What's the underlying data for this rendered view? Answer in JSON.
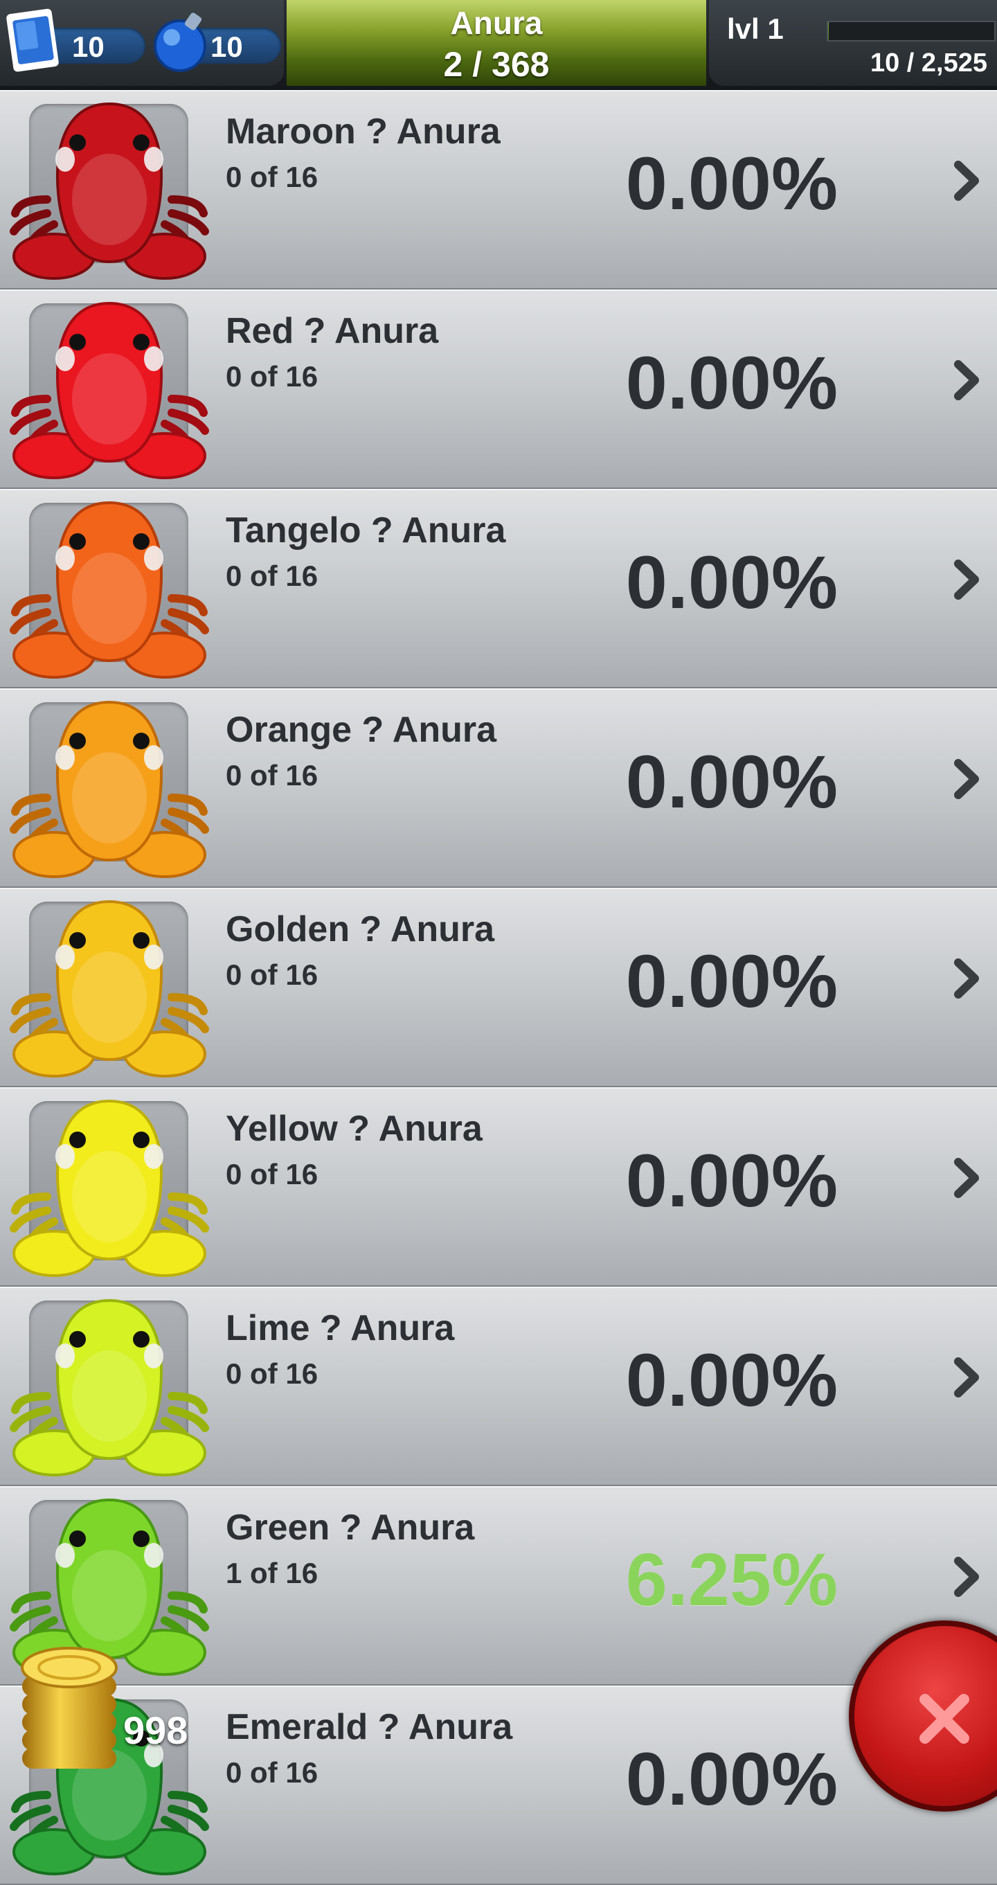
{
  "header": {
    "stamps_count": "10",
    "potions_count": "10",
    "title": "Anura",
    "collection_count": "2 / 368",
    "level_label": "lvl 1",
    "xp_text": "10 / 2,525",
    "xp_fraction": 0.004
  },
  "rows": [
    {
      "name": "Maroon ? Anura",
      "count": "0 of 16",
      "percent": "0.00%",
      "color": "#c7141c",
      "dark": "#7a0a0e"
    },
    {
      "name": "Red ? Anura",
      "count": "0 of 16",
      "percent": "0.00%",
      "color": "#ea1620",
      "dark": "#a20c12"
    },
    {
      "name": "Tangelo ? Anura",
      "count": "0 of 16",
      "percent": "0.00%",
      "color": "#f2641a",
      "dark": "#b63e08"
    },
    {
      "name": "Orange ? Anura",
      "count": "0 of 16",
      "percent": "0.00%",
      "color": "#f6a01a",
      "dark": "#c06a06"
    },
    {
      "name": "Golden ? Anura",
      "count": "0 of 16",
      "percent": "0.00%",
      "color": "#f6c51c",
      "dark": "#c48a08"
    },
    {
      "name": "Yellow ? Anura",
      "count": "0 of 16",
      "percent": "0.00%",
      "color": "#f3ec1c",
      "dark": "#bdb00a"
    },
    {
      "name": "Lime ? Anura",
      "count": "0 of 16",
      "percent": "0.00%",
      "color": "#d4f224",
      "dark": "#98b40c"
    },
    {
      "name": "Green ? Anura",
      "count": "1 of 16",
      "percent": "6.25%",
      "color": "#7ed62a",
      "dark": "#4a9a12"
    },
    {
      "name": "Emerald ? Anura",
      "count": "0 of 16",
      "percent": "0.00%",
      "color": "#2ea63c",
      "dark": "#16701e"
    }
  ],
  "footer": {
    "coin_count": "998"
  }
}
